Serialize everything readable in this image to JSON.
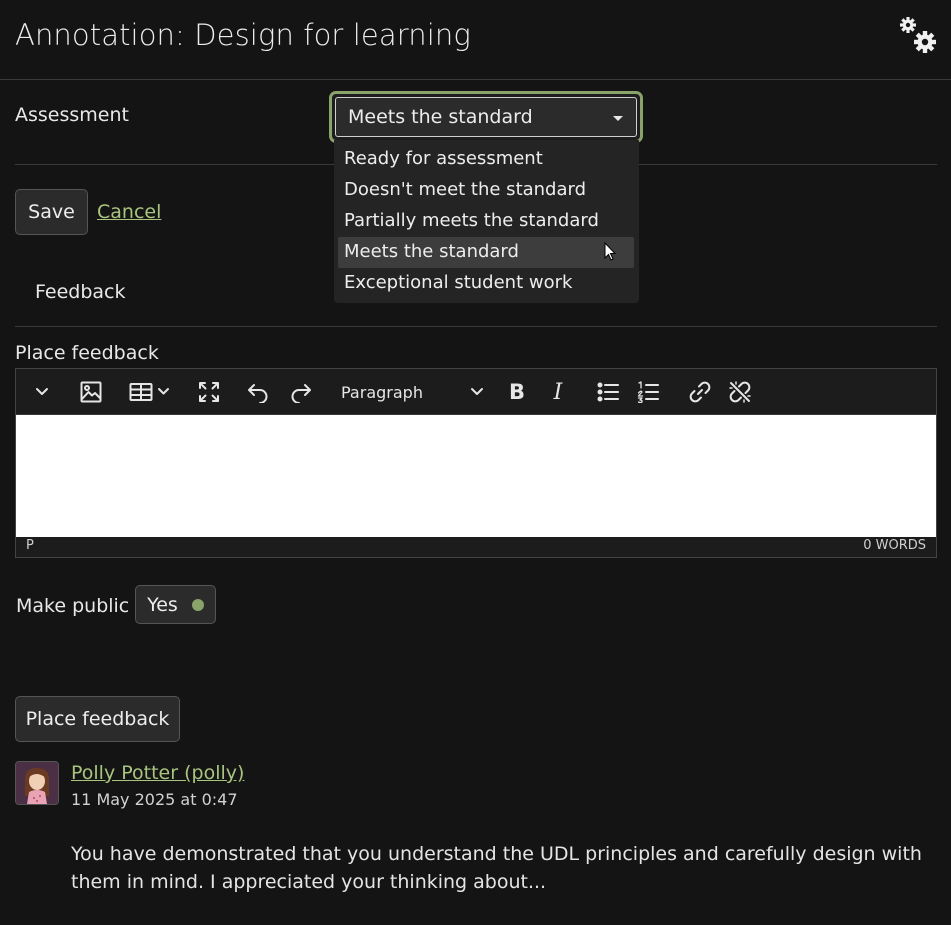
{
  "header": {
    "title": "Annotation: Design for learning",
    "settings_icon": "gears-icon"
  },
  "assessment": {
    "label": "Assessment",
    "selected": "Meets the standard",
    "options": [
      "Ready for assessment",
      "Doesn't meet the standard",
      "Partially meets the standard",
      "Meets the standard",
      "Exceptional student work"
    ],
    "highlighted_index": 3
  },
  "actions": {
    "save": "Save",
    "cancel": "Cancel"
  },
  "tab": {
    "feedback": "Feedback"
  },
  "editor": {
    "label": "Place feedback",
    "block_format": "Paragraph",
    "path": "P",
    "word_count": "0 WORDS"
  },
  "make_public": {
    "label": "Make public",
    "value": "Yes"
  },
  "submit": {
    "label": "Place feedback"
  },
  "feedback_entry": {
    "author": "Polly Potter (polly)",
    "date": "11 May 2025 at 0:47",
    "text": "You have demonstrated that you understand the UDL principles and carefully design with them in mind. I appreciated your thinking about..."
  },
  "colors": {
    "accent": "#a9c47f",
    "focus_ring": "#8aa36a",
    "background": "#141414"
  }
}
